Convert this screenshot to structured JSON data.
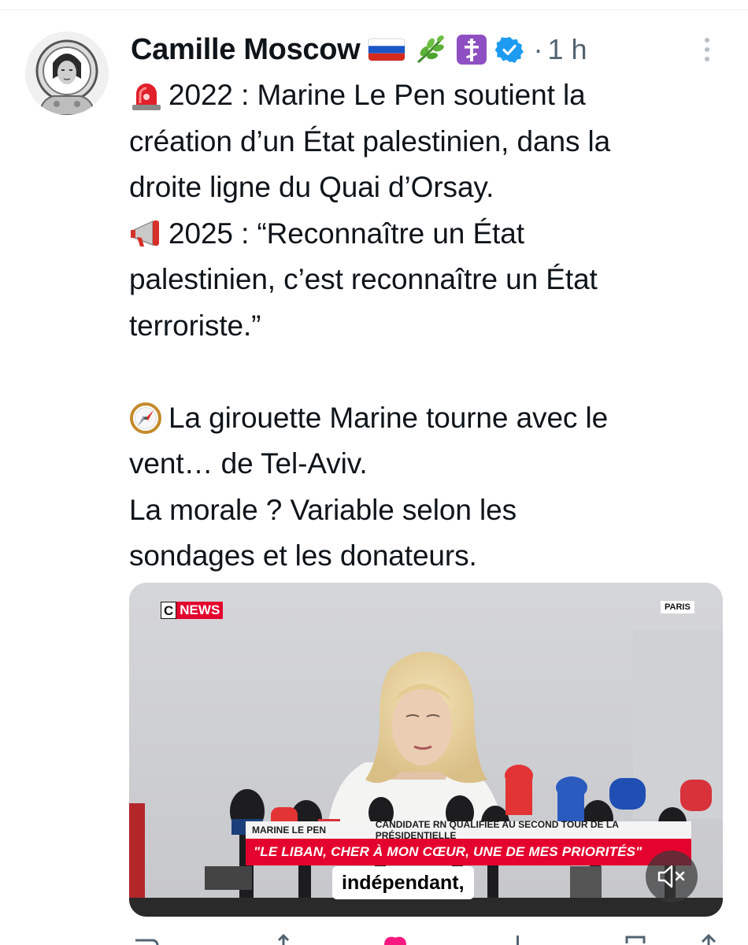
{
  "tweet": {
    "author_name": "Camille Moscow",
    "header_icons": [
      "russia-flag-icon",
      "herb-icon",
      "orthodox-cross-icon",
      "verified-badge-icon"
    ],
    "separator": "·",
    "time": "1 h",
    "lines": [
      {
        "icon": "siren-icon",
        "text": "2022 : Marine Le Pen soutient la"
      },
      {
        "icon": null,
        "text": "création d’un État palestinien, dans la"
      },
      {
        "icon": null,
        "text": "droite ligne du Quai d’Orsay."
      },
      {
        "icon": "megaphone-icon",
        "text": "2025 : “Reconnaître un État"
      },
      {
        "icon": null,
        "text": "palestinien, c’est reconnaître un État"
      },
      {
        "icon": null,
        "text": "terroriste.”"
      },
      {
        "icon": null,
        "text": ""
      },
      {
        "icon": "compass-icon",
        "text": "La girouette Marine tourne avec le"
      },
      {
        "icon": null,
        "text": "vent… de Tel-Aviv."
      },
      {
        "icon": null,
        "text": "La morale ? Variable selon les"
      },
      {
        "icon": null,
        "text": "sondages et les donateurs."
      }
    ]
  },
  "video": {
    "channel_c": "C",
    "channel_news": "NEWS",
    "location": "PARIS",
    "lower_third_name": "MARINE LE PEN",
    "lower_third_role": "CANDIDATE RN QUALIFIÉE AU SECOND TOUR DE LA PRÉSIDENTIELLE",
    "lower_third_quote": "\"LE LIBAN, CHER À MON CŒUR, UNE DE MES PRIORITÉS\"",
    "subtitle": "indépendant,",
    "mute_icon": "speaker-muted-icon"
  },
  "colors": {
    "text": "#0f1419",
    "secondary": "#536471",
    "verified": "#1d9bf0",
    "cnews_red": "#e4032e"
  }
}
